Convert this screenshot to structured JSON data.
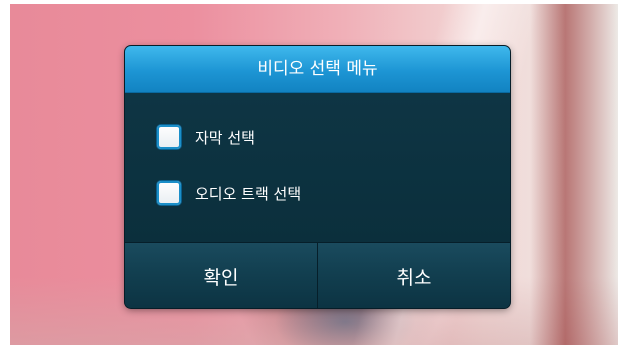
{
  "dialog": {
    "title": "비디오 선택 메뉴",
    "options": [
      {
        "label": "자막 선택",
        "checked": false
      },
      {
        "label": "오디오 트랙 선택",
        "checked": false
      }
    ],
    "buttons": {
      "confirm": "확인",
      "cancel": "취소"
    }
  },
  "colors": {
    "title_bar": "#1d95d4",
    "dialog_bg": "#0d3140",
    "checkbox_border": "#1b8fc9"
  }
}
